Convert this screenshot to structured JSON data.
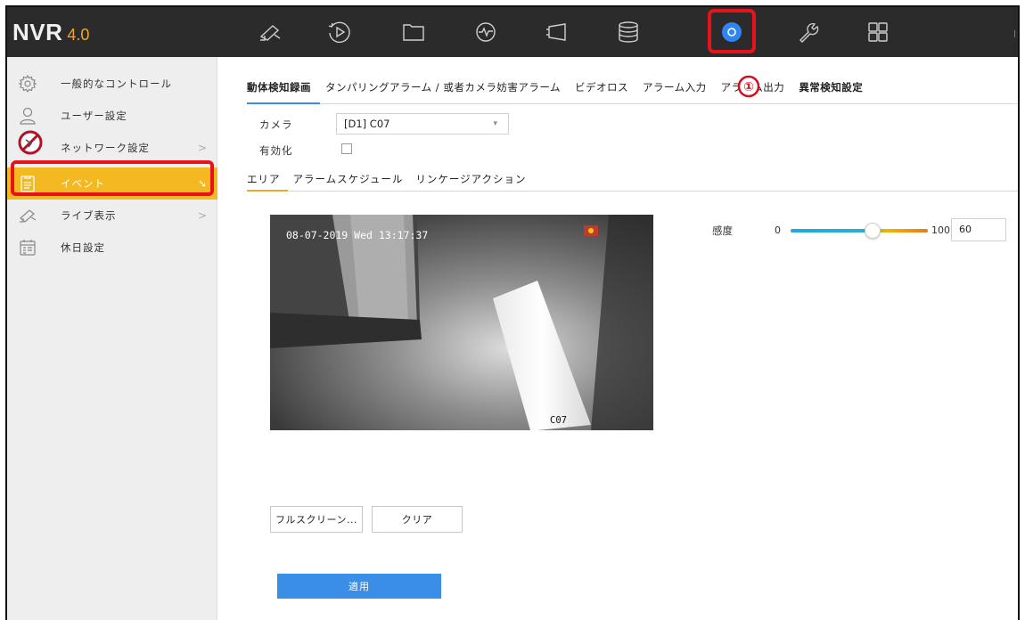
{
  "app": {
    "brand": "NVR",
    "version": "4.0"
  },
  "topbar": {
    "icons": [
      "live-view-camera-icon",
      "playback-icon",
      "file-folder-icon",
      "smart-analysis-icon",
      "camera-management-icon",
      "storage-icon",
      "configuration-gear-icon",
      "maintenance-wrench-icon",
      "apps-grid-icon"
    ],
    "highlight": "configuration-gear-icon"
  },
  "sidebar": {
    "items": [
      {
        "label": "一般的なコントロール",
        "icon": "gear-outline-icon",
        "arrow": ""
      },
      {
        "label": "ユーザー設定",
        "icon": "user-icon",
        "arrow": ""
      },
      {
        "label": "ネットワーク設定",
        "icon": "network-icon",
        "arrow": ">"
      },
      {
        "label": "イベント",
        "icon": "clipboard-icon",
        "arrow": ""
      },
      {
        "label": "ライブ表示",
        "icon": "camera-icon",
        "arrow": ">"
      },
      {
        "label": "休日設定",
        "icon": "calendar-icon",
        "arrow": ""
      }
    ],
    "active": "イベント"
  },
  "main": {
    "tabs": [
      {
        "label": "動体検知録画",
        "active": true
      },
      {
        "label": "タンパリングアラーム / 或者カメラ妨害アラーム",
        "active": false
      },
      {
        "label": "ビデオロス",
        "active": false
      },
      {
        "label": "アラーム入力",
        "active": false
      },
      {
        "label": "アラーム出力",
        "active": false
      },
      {
        "label": "異常検知設定",
        "active": false
      }
    ],
    "annotation_marker": "①",
    "camera_label": "カメラ",
    "camera_value": "[D1] C07",
    "enable_label": "有効化",
    "enable_checked": false,
    "subtabs": [
      {
        "label": "エリア",
        "active": true
      },
      {
        "label": "アラームスケジュール",
        "active": false
      },
      {
        "label": "リンケージアクション",
        "active": false
      }
    ],
    "video": {
      "timestamp": "08-07-2019 Wed 13:17:37",
      "channel_name": "C07"
    },
    "sensitivity": {
      "label": "感度",
      "min": "0",
      "max": "100",
      "value": "60",
      "level": 0.6
    },
    "fullscreen_label": "フルスクリーン...",
    "clear_label": "クリア",
    "apply_label": "適用"
  },
  "colors": {
    "topbar_bg": "#2b2b2b",
    "accent_blue": "#3a8ee6",
    "active_orange": "#f4b820",
    "highlight_red": "#e8121c"
  }
}
